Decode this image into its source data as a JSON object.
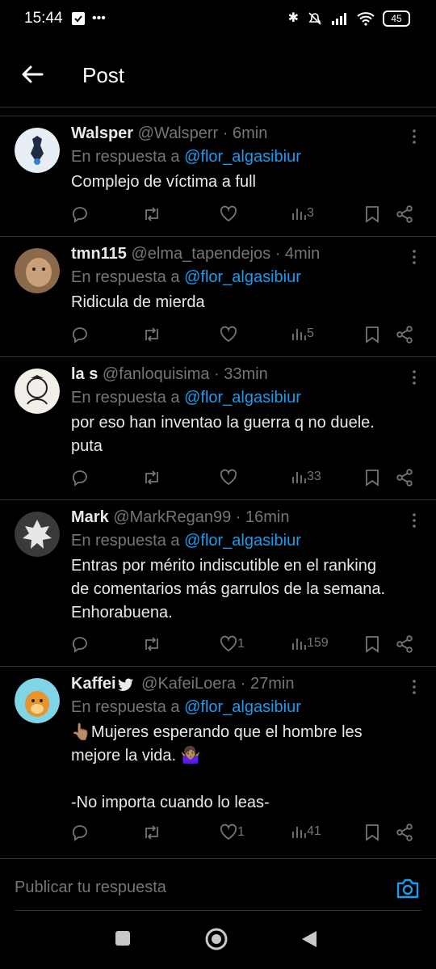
{
  "status_bar": {
    "time": "15:44",
    "battery": "45"
  },
  "header": {
    "title": "Post"
  },
  "posts": [
    {
      "name": "Walsper",
      "handle": "@Walsperr",
      "time": "6min",
      "reply_prefix": "En respuesta a",
      "reply_to": "@flor_algasibiur",
      "text": "Complejo de víctima a full",
      "likes": "",
      "views": "3",
      "avatar_color": "#e8eef5"
    },
    {
      "name": "tmn115",
      "handle": "@elma_tapendejos",
      "time": "4min",
      "reply_prefix": "En respuesta a",
      "reply_to": "@flor_algasibiur",
      "text": "Ridicula de mierda",
      "likes": "",
      "views": "5",
      "avatar_color": "#8a6a4a"
    },
    {
      "name": "la s",
      "handle": "@fanloquisima",
      "time": "33min",
      "reply_prefix": "En respuesta a",
      "reply_to": "@flor_algasibiur",
      "text": "por eso han inventao la guerra q no duele.\nputa",
      "likes": "",
      "views": "33",
      "avatar_color": "#f2efe8"
    },
    {
      "name": "Mark",
      "handle": "@MarkRegan99",
      "time": "16min",
      "reply_prefix": "En respuesta a",
      "reply_to": "@flor_algasibiur",
      "text": "Entras por mérito indiscutible en el ranking\nde comentarios más garrulos de la semana.\nEnhorabuena.",
      "likes": "1",
      "views": "159",
      "avatar_color": "#3a3a3a"
    },
    {
      "name": "Kaffei",
      "handle": "@KafeiLoera",
      "time": "27min",
      "reply_prefix": "En respuesta a",
      "reply_to": "@flor_algasibiur",
      "text": "👆🏽Mujeres esperando que el hombre les\nmejore la vida. 🤷🏽‍♀️\n\n-No importa cuando lo leas-",
      "likes": "1",
      "views": "41",
      "avatar_color": "#7fd4e6"
    }
  ],
  "composer": {
    "placeholder": "Publicar tu respuesta"
  },
  "colors": {
    "accent": "#1d9bf0",
    "muted": "#71767b",
    "divider": "#2f3336"
  }
}
